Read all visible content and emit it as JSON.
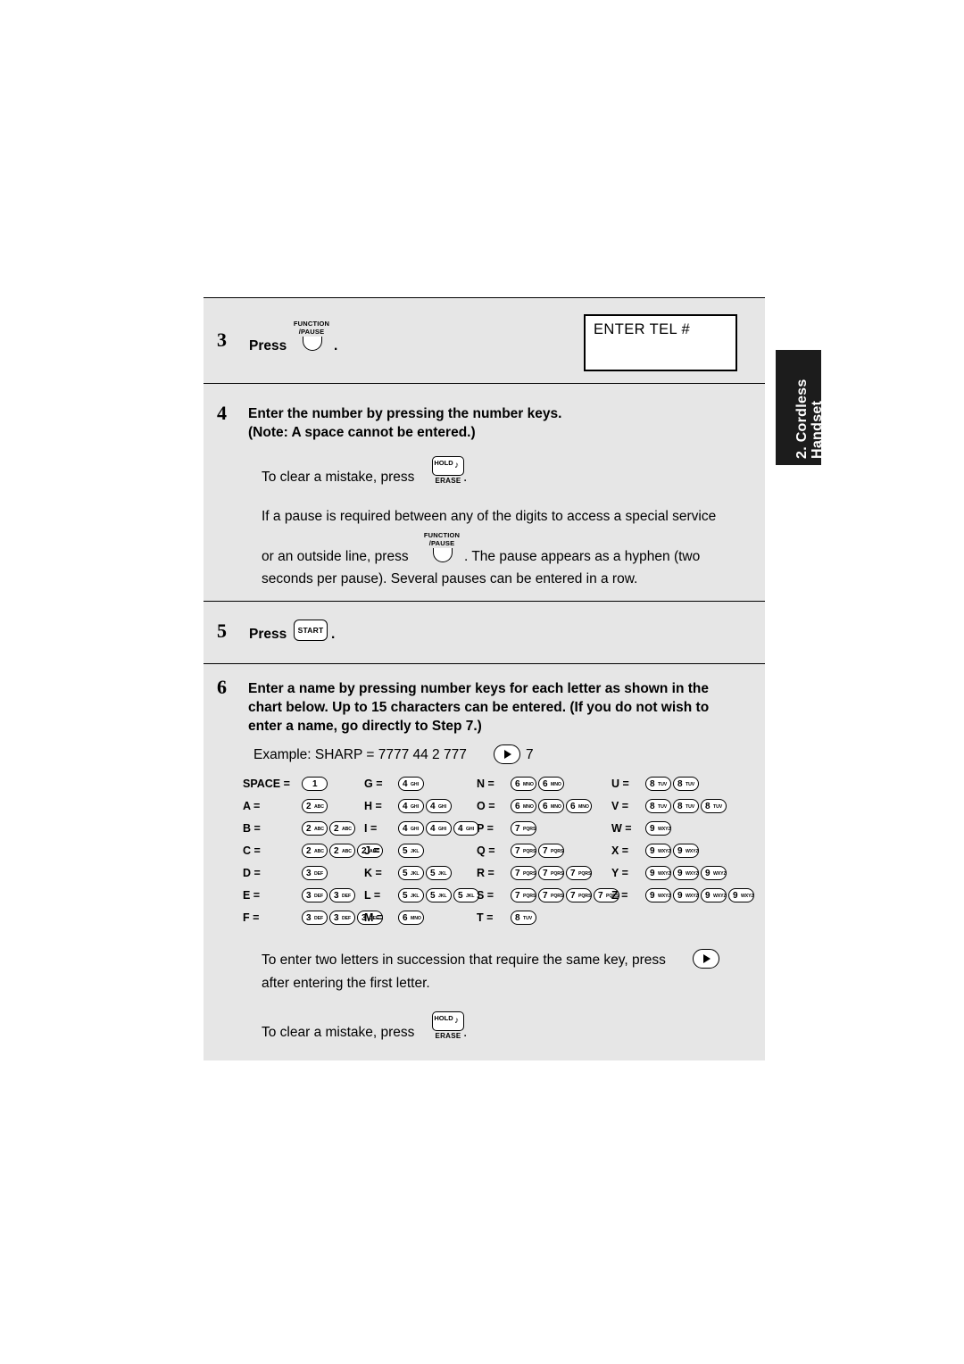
{
  "sidetab": {
    "line1": "2. Cordless",
    "line2": "Handset"
  },
  "steps": {
    "s3": {
      "num": "3",
      "press": "Press",
      "trailing": "."
    },
    "s4": {
      "num": "4",
      "line1": "Enter the number by pressing the number keys.",
      "line2": "(Note: A space cannot be entered.)",
      "clear_before": "To clear a mistake, press",
      "clear_after": ".",
      "pause_line1": "If a pause is required between any of the digits to access a special service",
      "pause_before": "or an outside line, press",
      "pause_after": ". The pause appears as a hyphen (two",
      "pause_line3": "seconds per pause). Several pauses can be entered in a row."
    },
    "s5": {
      "num": "5",
      "press": "Press",
      "trailing": "."
    },
    "s6": {
      "num": "6",
      "line1": "Enter a name by pressing number keys for each letter as shown in the",
      "line2": "chart below. Up to 15 characters can be entered. (If you do not wish to",
      "line3": "enter a name, go directly to Step 7.)",
      "example_before": "Example: SHARP = 7777  44  2  777",
      "example_after": "7",
      "succ_before": "To enter two letters in succession that require the same key, press",
      "succ_line2": "after entering the first letter.",
      "clear_before": "To clear a mistake, press",
      "clear_after": "."
    }
  },
  "lcd": {
    "text": "ENTER TEL #"
  },
  "keys": {
    "function_pause": {
      "label_line1": "FUNCTION",
      "label_line2": "/PAUSE",
      "name": "function-pause-key"
    },
    "hold_erase": {
      "top": "HOLD",
      "bottom": "ERASE",
      "name": "hold-erase-key"
    },
    "start": {
      "label": "START",
      "name": "start-key"
    },
    "arrow": {
      "name": "right-arrow-key"
    }
  },
  "chart": {
    "columns": [
      {
        "rows": [
          {
            "label": "SPACE =",
            "keys": [
              {
                "digit": "1",
                "sub": ""
              }
            ]
          },
          {
            "label": "A =",
            "keys": [
              {
                "digit": "2",
                "sub": "ABC"
              }
            ]
          },
          {
            "label": "B =",
            "keys": [
              {
                "digit": "2",
                "sub": "ABC"
              },
              {
                "digit": "2",
                "sub": "ABC"
              }
            ]
          },
          {
            "label": "C =",
            "keys": [
              {
                "digit": "2",
                "sub": "ABC"
              },
              {
                "digit": "2",
                "sub": "ABC"
              },
              {
                "digit": "2",
                "sub": "ABC"
              }
            ]
          },
          {
            "label": "D =",
            "keys": [
              {
                "digit": "3",
                "sub": "DEF"
              }
            ]
          },
          {
            "label": "E =",
            "keys": [
              {
                "digit": "3",
                "sub": "DEF"
              },
              {
                "digit": "3",
                "sub": "DEF"
              }
            ]
          },
          {
            "label": "F =",
            "keys": [
              {
                "digit": "3",
                "sub": "DEF"
              },
              {
                "digit": "3",
                "sub": "DEF"
              },
              {
                "digit": "3",
                "sub": "DEF"
              }
            ]
          }
        ]
      },
      {
        "rows": [
          {
            "label": "G =",
            "keys": [
              {
                "digit": "4",
                "sub": "GHI"
              }
            ]
          },
          {
            "label": "H =",
            "keys": [
              {
                "digit": "4",
                "sub": "GHI"
              },
              {
                "digit": "4",
                "sub": "GHI"
              }
            ]
          },
          {
            "label": "I =",
            "keys": [
              {
                "digit": "4",
                "sub": "GHI"
              },
              {
                "digit": "4",
                "sub": "GHI"
              },
              {
                "digit": "4",
                "sub": "GHI"
              }
            ]
          },
          {
            "label": "J =",
            "keys": [
              {
                "digit": "5",
                "sub": "JKL"
              }
            ]
          },
          {
            "label": "K =",
            "keys": [
              {
                "digit": "5",
                "sub": "JKL"
              },
              {
                "digit": "5",
                "sub": "JKL"
              }
            ]
          },
          {
            "label": "L =",
            "keys": [
              {
                "digit": "5",
                "sub": "JKL"
              },
              {
                "digit": "5",
                "sub": "JKL"
              },
              {
                "digit": "5",
                "sub": "JKL"
              }
            ]
          },
          {
            "label": "M =",
            "keys": [
              {
                "digit": "6",
                "sub": "MNO"
              }
            ]
          }
        ]
      },
      {
        "rows": [
          {
            "label": "N =",
            "keys": [
              {
                "digit": "6",
                "sub": "MNO"
              },
              {
                "digit": "6",
                "sub": "MNO"
              }
            ]
          },
          {
            "label": "O =",
            "keys": [
              {
                "digit": "6",
                "sub": "MNO"
              },
              {
                "digit": "6",
                "sub": "MNO"
              },
              {
                "digit": "6",
                "sub": "MNO"
              }
            ]
          },
          {
            "label": "P =",
            "keys": [
              {
                "digit": "7",
                "sub": "PQRS"
              }
            ]
          },
          {
            "label": "Q =",
            "keys": [
              {
                "digit": "7",
                "sub": "PQRS"
              },
              {
                "digit": "7",
                "sub": "PQRS"
              }
            ]
          },
          {
            "label": "R =",
            "keys": [
              {
                "digit": "7",
                "sub": "PQRS"
              },
              {
                "digit": "7",
                "sub": "PQRS"
              },
              {
                "digit": "7",
                "sub": "PQRS"
              }
            ]
          },
          {
            "label": "S =",
            "keys": [
              {
                "digit": "7",
                "sub": "PQRS"
              },
              {
                "digit": "7",
                "sub": "PQRS"
              },
              {
                "digit": "7",
                "sub": "PQRS"
              },
              {
                "digit": "7",
                "sub": "PQRS"
              }
            ]
          },
          {
            "label": "T =",
            "keys": [
              {
                "digit": "8",
                "sub": "TUV"
              }
            ]
          }
        ]
      },
      {
        "rows": [
          {
            "label": "U =",
            "keys": [
              {
                "digit": "8",
                "sub": "TUV"
              },
              {
                "digit": "8",
                "sub": "TUV"
              }
            ]
          },
          {
            "label": "V =",
            "keys": [
              {
                "digit": "8",
                "sub": "TUV"
              },
              {
                "digit": "8",
                "sub": "TUV"
              },
              {
                "digit": "8",
                "sub": "TUV"
              }
            ]
          },
          {
            "label": "W =",
            "keys": [
              {
                "digit": "9",
                "sub": "WXYZ"
              }
            ]
          },
          {
            "label": "X =",
            "keys": [
              {
                "digit": "9",
                "sub": "WXYZ"
              },
              {
                "digit": "9",
                "sub": "WXYZ"
              }
            ]
          },
          {
            "label": "Y =",
            "keys": [
              {
                "digit": "9",
                "sub": "WXYZ"
              },
              {
                "digit": "9",
                "sub": "WXYZ"
              },
              {
                "digit": "9",
                "sub": "WXYZ"
              }
            ]
          },
          {
            "label": "Z =",
            "keys": [
              {
                "digit": "9",
                "sub": "WXYZ"
              },
              {
                "digit": "9",
                "sub": "WXYZ"
              },
              {
                "digit": "9",
                "sub": "WXYZ"
              },
              {
                "digit": "9",
                "sub": "WXYZ"
              }
            ]
          }
        ]
      }
    ]
  }
}
